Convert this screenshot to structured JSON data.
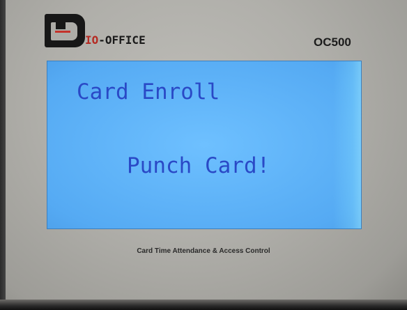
{
  "device": {
    "brand_prefix": "B",
    "brand_io": "IO",
    "brand_rest": "-OFFICE",
    "model": "OC500",
    "tagline": "Card Time Attendance & Access Control"
  },
  "lcd": {
    "title": "Card Enroll",
    "message": "Punch Card!"
  },
  "colors": {
    "lcd_background": "#5fb3f8",
    "lcd_text": "#2a49c6",
    "logo_accent": "#b52a22",
    "device_body": "#b3b2ad"
  }
}
